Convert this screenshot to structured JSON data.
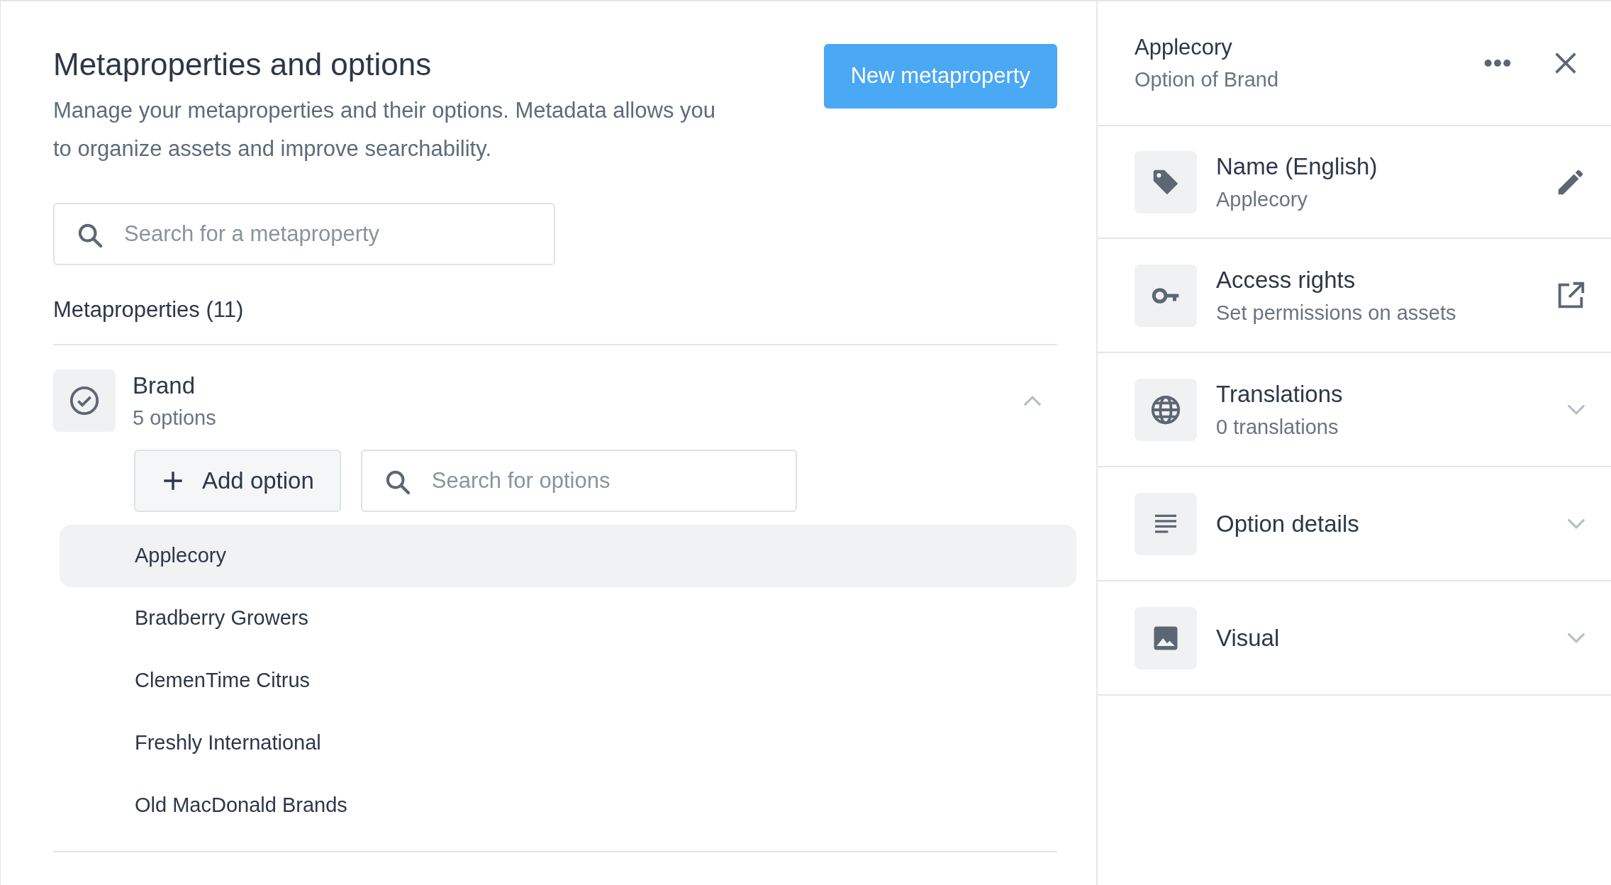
{
  "page": {
    "title": "Metaproperties and options",
    "description": "Manage your metaproperties and their options. Metadata allows you to organize assets and improve searchability.",
    "new_button": "New metaproperty",
    "search": {
      "placeholder": "Search for a metaproperty"
    }
  },
  "list": {
    "heading": "Metaproperties (11)",
    "metaproperties": [
      {
        "name": "Brand",
        "count": "5 options",
        "expanded": true,
        "add_button": "Add option",
        "search": {
          "placeholder": "Search for options"
        },
        "options": [
          {
            "label": "Applecory",
            "selected": true
          },
          {
            "label": "Bradberry Growers",
            "selected": false
          },
          {
            "label": "ClemenTime Citrus",
            "selected": false
          },
          {
            "label": "Freshly International",
            "selected": false
          },
          {
            "label": "Old MacDonald Brands",
            "selected": false
          }
        ]
      }
    ]
  },
  "detail_panel": {
    "title": "Applecory",
    "subtitle": "Option of Brand",
    "sections": [
      {
        "kind": "edit",
        "title": "Name (English)",
        "subtitle": "Applecory"
      },
      {
        "kind": "link",
        "title": "Access rights",
        "subtitle": "Set permissions on assets"
      },
      {
        "kind": "expand",
        "title": "Translations",
        "subtitle": "0 translations",
        "expanded": false
      },
      {
        "kind": "expand",
        "title": "Option details",
        "expanded": false
      },
      {
        "kind": "expand",
        "title": "Visual",
        "expanded": false
      }
    ]
  }
}
